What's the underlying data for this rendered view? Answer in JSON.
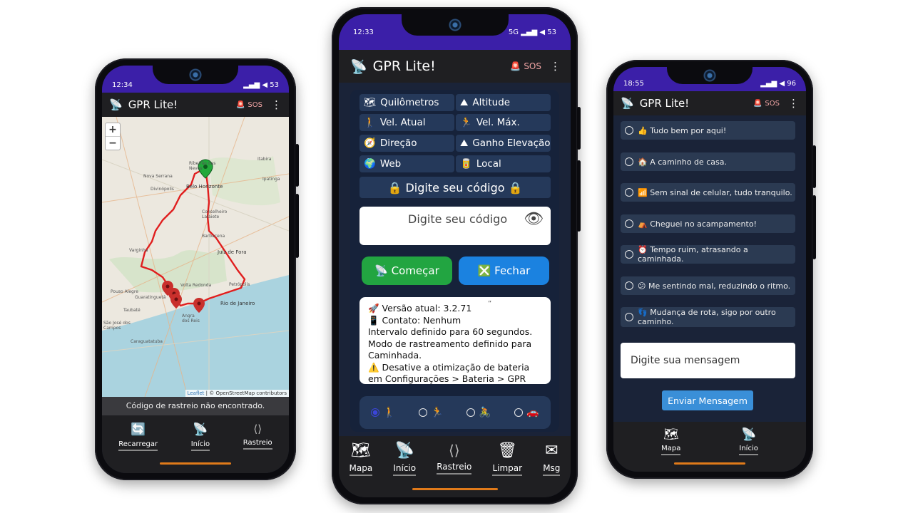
{
  "app": {
    "title": "GPR Lite!",
    "sos_label": "SOS",
    "menu_glyph": "⋮",
    "title_icon": "📡",
    "sos_icon": "🚨"
  },
  "left_phone": {
    "status": {
      "time": "12:34",
      "icons": "▂▄▆ ◀ 53"
    },
    "map": {
      "zoom_in": "+",
      "zoom_out": "−",
      "labels": {
        "nova_serrana": "Nova Serrana",
        "divinopolis": "Divinópolis",
        "ribeirao": "Ribeirão das Neves",
        "belo_horizonte": "Belo Horizonte",
        "itabira": "Itabira",
        "ipatinga": "Ipatinga",
        "conselheiro": "Conselheiro Lafaiete",
        "barbacena": "Barbacena",
        "juiz_de_fora": "Juiz de Fora",
        "varginha": "Varginha",
        "volta_redonda": "Volta Redonda",
        "petropolis": "Petrópolis",
        "rio_de_janeiro": "Rio de Janeiro",
        "guaratingueta": "Guaratinguetá",
        "angra": "Angra dos Reis",
        "sao_jose": "São José dos Campos",
        "caraguatatuba": "Caraguatatuba",
        "taubate": "Taubaté",
        "pouso_alegre": "Pouso Alegre"
      },
      "attribution_leaflet": "Leaflet",
      "attribution_rest": " | © OpenStreetMap contributors"
    },
    "info": "Código de rastreio não encontrado.",
    "nav": [
      {
        "icon": "🔄",
        "label": "Recarregar"
      },
      {
        "icon": "📡",
        "label": "Início"
      },
      {
        "icon": "⟨⟩",
        "label": "Rastreio"
      }
    ]
  },
  "center_phone": {
    "status": {
      "time": "12:33",
      "icons": "5G ▂▄▆ ◀ 53"
    },
    "grid": [
      {
        "icon": "🗺",
        "label": "Quilômetros"
      },
      {
        "icon": "⛰",
        "label": "Altitude"
      },
      {
        "icon": "🚶",
        "label": "Vel. Atual"
      },
      {
        "icon": "🏃",
        "label": "Vel. Máx."
      },
      {
        "icon": "🧭",
        "label": "Direção"
      },
      {
        "icon": "⛰",
        "label": "Ganho Elevação"
      },
      {
        "icon": "🌍",
        "label": "Web"
      },
      {
        "icon": "🥫",
        "label": "Local"
      }
    ],
    "code_button": "🔒 Digite seu código 🔒",
    "code_placeholder": "Digite seu código",
    "eye_icon": "👁",
    "start_button": "📡 Começar",
    "close_button": "❎ Fechar",
    "log": {
      "quote_mark": "”",
      "lines": [
        "🚀 Versão atual: 3.2.71",
        "📱 Contato: Nenhum",
        "Intervalo definido para 60 segundos.",
        "Modo de rastreamento definido para Caminhada.",
        "⚠️ Desative a otimização de bateria em Configurações > Bateria > GPR Lite"
      ]
    },
    "modes": [
      {
        "icon": "🚶",
        "selected": true
      },
      {
        "icon": "🏃",
        "selected": false
      },
      {
        "icon": "🚴",
        "selected": false
      },
      {
        "icon": "🚗",
        "selected": false
      }
    ],
    "nav": [
      {
        "icon": "🗺",
        "label": "Mapa"
      },
      {
        "icon": "📡",
        "label": "Início"
      },
      {
        "icon": "⟨⟩",
        "label": "Rastreio"
      },
      {
        "icon": "🗑",
        "label": "Limpar"
      },
      {
        "icon": "✉",
        "label": "Msg"
      }
    ]
  },
  "right_phone": {
    "status": {
      "time": "18:55",
      "icons": "▂▄▆ ◀ 96"
    },
    "messages": [
      "👍 Tudo bem por aqui!",
      "🏠 A caminho de casa.",
      "📶 Sem sinal de celular, tudo tranquilo.",
      "⛺ Cheguei no acampamento!",
      "⏰ Tempo ruim, atrasando a caminhada.",
      "😕 Me sentindo mal, reduzindo o ritmo.",
      "👣 Mudança de rota, sigo por outro caminho."
    ],
    "message_placeholder": "Digite sua mensagem",
    "send_button": "Enviar Mensagem",
    "nav": [
      {
        "icon": "🗺",
        "label": "Mapa"
      },
      {
        "icon": "📡",
        "label": "Início"
      }
    ]
  }
}
